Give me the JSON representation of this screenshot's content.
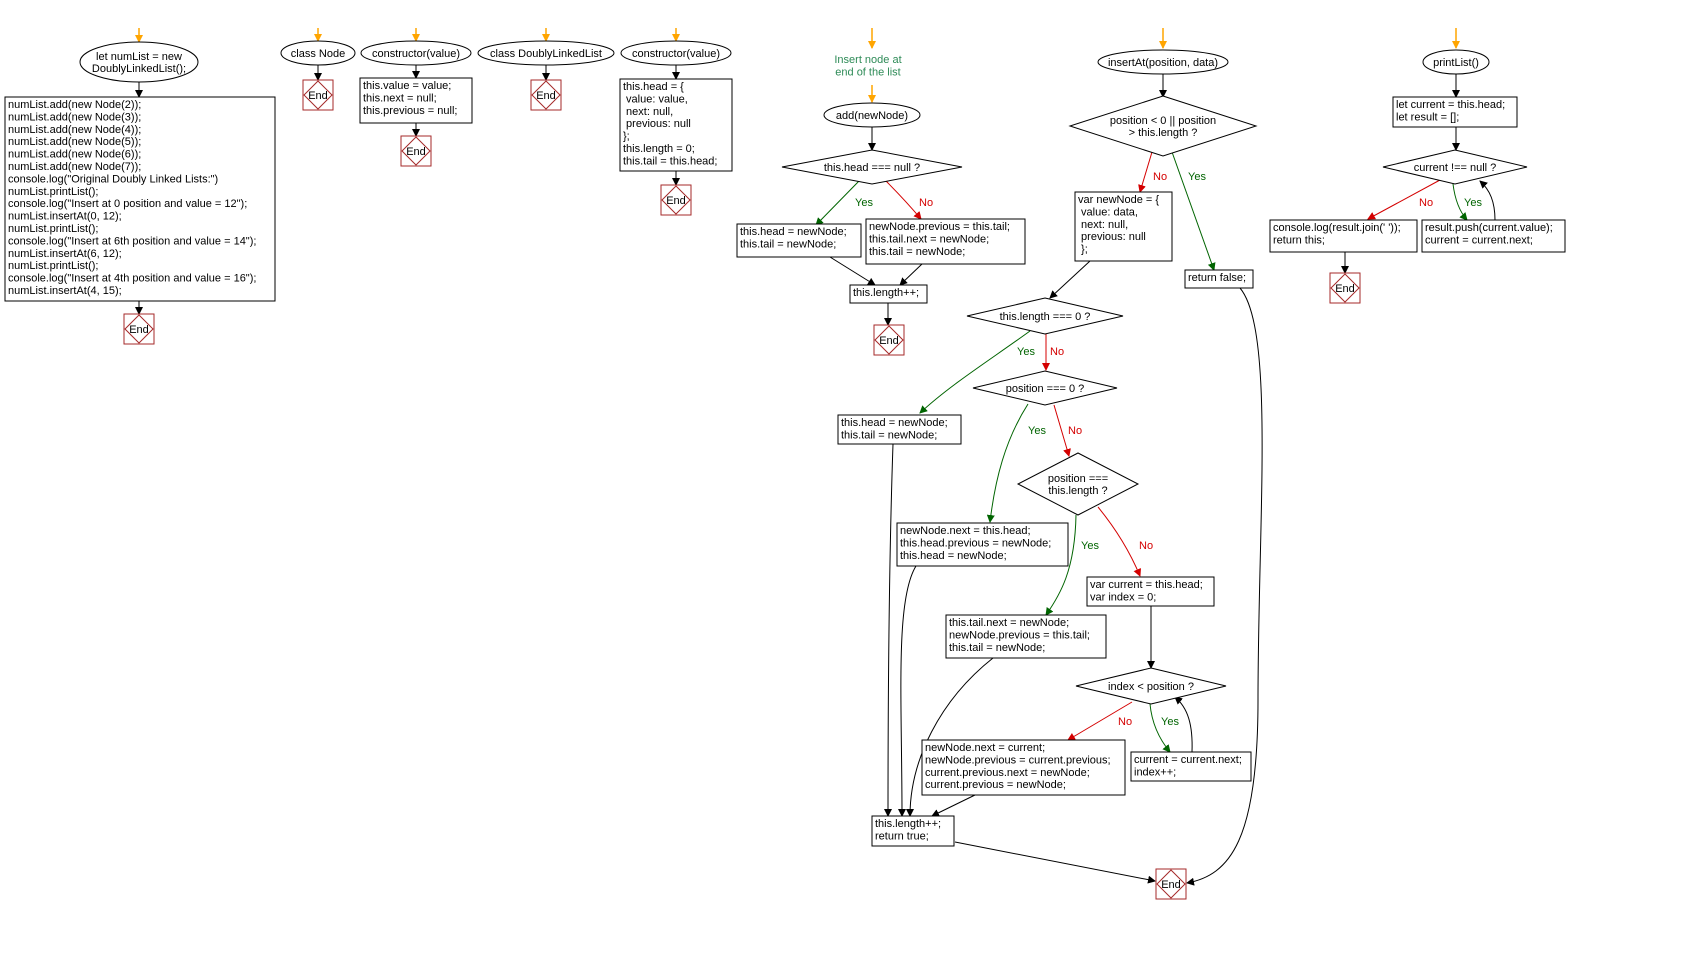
{
  "diagram": {
    "end_label": "End",
    "yes_label": "Yes",
    "no_label": "No",
    "annotation": [
      "Insert node at",
      "end of the list"
    ],
    "colors": {
      "start_arrow": "#ffa500",
      "yes_edge": "#006400",
      "no_edge": "#d40000",
      "end_border": "#a52a2a",
      "annotation": "#2e8b57"
    },
    "nodes": {
      "main_start": [
        "let numList = new",
        "DoublyLinkedList();"
      ],
      "main_body": [
        "numList.add(new Node(2));",
        "numList.add(new Node(3));",
        "numList.add(new Node(4));",
        "numList.add(new Node(5));",
        "numList.add(new Node(6));",
        "numList.add(new Node(7));",
        "console.log(\"Original Doubly Linked Lists:\")",
        "numList.printList();",
        "console.log(\"Insert at 0 position and value = 12\");",
        "numList.insertAt(0, 12);",
        "numList.printList();",
        "console.log(\"Insert at 6th position and value = 14\");",
        "numList.insertAt(6, 12);",
        "numList.printList();",
        "console.log(\"Insert at 4th position and value = 16\");",
        "numList.insertAt(4, 15);"
      ],
      "node_class": [
        "class Node"
      ],
      "node_ctor": [
        "constructor(value)"
      ],
      "node_ctor_body": [
        "this.value = value;",
        "this.next = null;",
        "this.previous = null;"
      ],
      "dll_class": [
        "class DoublyLinkedList"
      ],
      "dll_ctor": [
        "constructor(value)"
      ],
      "dll_ctor_body": [
        "this.head = {",
        " value: value,",
        " next: null,",
        " previous: null",
        "};",
        "this.length = 0;",
        "this.tail = this.head;"
      ],
      "add_start": [
        "add(newNode)"
      ],
      "add_cond": [
        "this.head === null ?"
      ],
      "add_yes": [
        "this.head = newNode;",
        "this.tail = newNode;"
      ],
      "add_no": [
        "newNode.previous = this.tail;",
        "this.tail.next = newNode;",
        "this.tail = newNode;"
      ],
      "add_len": [
        "this.length++;"
      ],
      "ins_start": [
        "insertAt(position, data)"
      ],
      "ins_cond_range": [
        "position < 0 || position",
        "> this.length ?"
      ],
      "ins_return_false": [
        "return false;"
      ],
      "ins_new_node": [
        "var newNode = {",
        "  value: data,",
        "  next: null,",
        "  previous: null",
        " };"
      ],
      "ins_cond_empty": [
        "this.length === 0 ?"
      ],
      "ins_empty_yes": [
        "this.head = newNode;",
        "this.tail = newNode;"
      ],
      "ins_cond_pos0": [
        "position === 0 ?"
      ],
      "ins_pos0_yes": [
        "newNode.next = this.head;",
        "this.head.previous = newNode;",
        "this.head = newNode;"
      ],
      "ins_cond_poslen": [
        "position ===",
        "this.length ?"
      ],
      "ins_poslen_yes": [
        "this.tail.next = newNode;",
        "newNode.previous = this.tail;",
        "this.tail = newNode;"
      ],
      "ins_init_current": [
        "var current = this.head;",
        "var index = 0;"
      ],
      "ins_cond_index": [
        "index < position ?"
      ],
      "ins_advance": [
        "current = current.next;",
        "index++;"
      ],
      "ins_link": [
        "newNode.next = current;",
        "newNode.previous = current.previous;",
        "current.previous.next = newNode;",
        "current.previous = newNode;"
      ],
      "ins_len_return": [
        "this.length++;",
        "return true;"
      ],
      "print_start": [
        "printList()"
      ],
      "print_init": [
        "let current = this.head;",
        "let result = [];"
      ],
      "print_cond": [
        "current !== null ?"
      ],
      "print_out": [
        "console.log(result.join(' '));",
        "return this;"
      ],
      "print_push": [
        "result.push(current.value);",
        "current = current.next;"
      ]
    }
  }
}
